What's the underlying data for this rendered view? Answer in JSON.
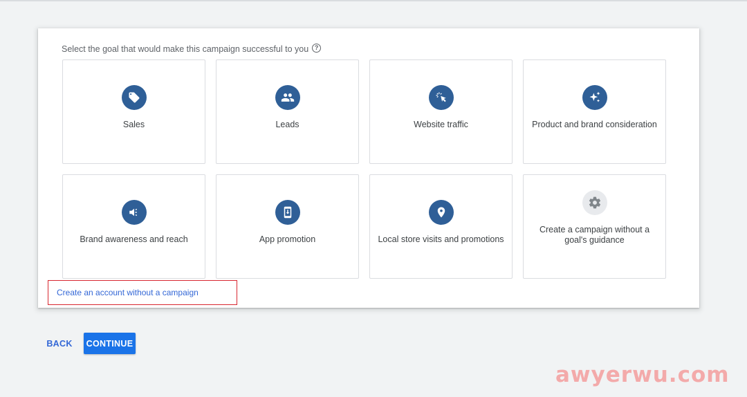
{
  "prompt": {
    "text": "Select the goal that would make this campaign successful to you",
    "help_glyph": "?"
  },
  "goals": [
    {
      "label": "Sales",
      "icon": "tag-icon"
    },
    {
      "label": "Leads",
      "icon": "people-icon"
    },
    {
      "label": "Website traffic",
      "icon": "cursor-click-icon"
    },
    {
      "label": "Product and brand consideration",
      "icon": "sparkle-icon"
    },
    {
      "label": "Brand awareness and reach",
      "icon": "megaphone-icon"
    },
    {
      "label": "App promotion",
      "icon": "phone-download-icon"
    },
    {
      "label": "Local store visits and promotions",
      "icon": "location-pin-icon"
    },
    {
      "label": "Create a campaign without a goal's guidance",
      "icon": "gear-icon"
    }
  ],
  "account_link": "Create an account without a campaign",
  "buttons": {
    "back": "BACK",
    "continue": "CONTINUE"
  },
  "watermark": "awyerwu.com",
  "colors": {
    "icon_bg": "#2f5f97",
    "primary": "#1a73e8",
    "link": "#3367d6",
    "highlight_border": "#d8262f"
  }
}
